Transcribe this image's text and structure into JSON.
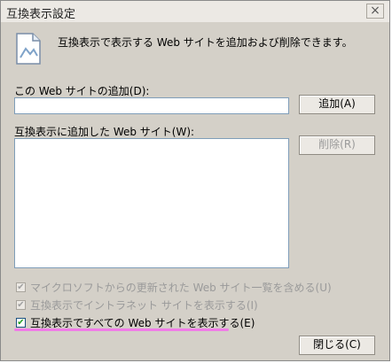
{
  "window": {
    "title": "互換表示設定",
    "close_glyph": "×"
  },
  "description": "互換表示で表示する Web サイトを追加および削除できます。",
  "add_section": {
    "label": "この Web サイトの追加(D):",
    "input_value": "",
    "add_button": "追加(A)"
  },
  "list_section": {
    "label": "互換表示に追加した Web サイト(W):",
    "items": [],
    "remove_button": "削除(R)"
  },
  "checkboxes": [
    {
      "label": "マイクロソフトからの更新された Web サイト一覧を含める(U)",
      "checked": true,
      "enabled": false,
      "mark": "✔"
    },
    {
      "label": "互換表示でイントラネット サイトを表示する(I)",
      "checked": true,
      "enabled": false,
      "mark": "✔"
    },
    {
      "label": "互換表示ですべての Web サイトを表示する(E)",
      "checked": true,
      "enabled": true,
      "mark": "✔"
    }
  ],
  "close_button": "閉じる(C)",
  "colors": {
    "highlight": "#f07ce7",
    "dialog_bg": "#d4d0c8"
  },
  "icons": {
    "document": "document-image-icon"
  }
}
